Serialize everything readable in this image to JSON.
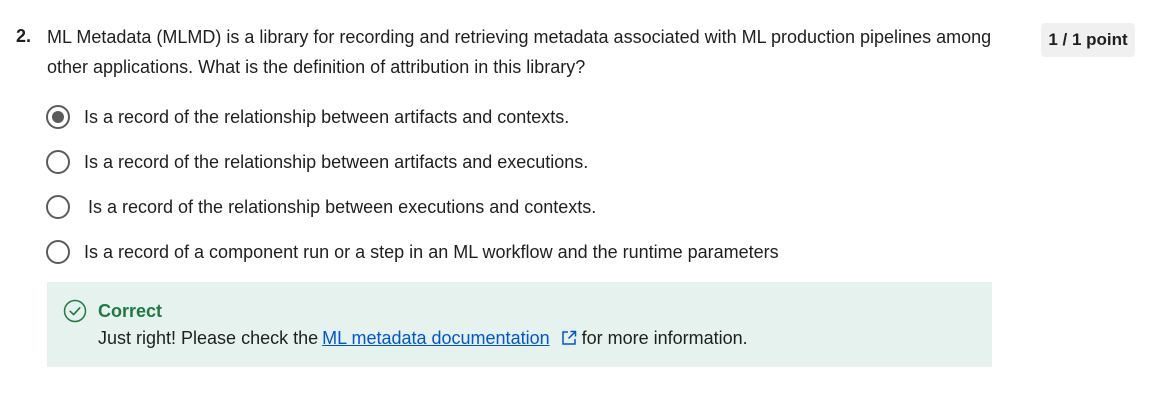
{
  "question": {
    "number": "2.",
    "text": "ML Metadata (MLMD) is a library for recording and retrieving metadata associated with ML production pipelines among other applications. What is the definition of attribution in this library?",
    "points": "1 / 1 point"
  },
  "options": [
    {
      "label": "Is a record of the relationship between artifacts and contexts.",
      "selected": true
    },
    {
      "label": "Is a record of the relationship between artifacts and executions.",
      "selected": false
    },
    {
      "label": "Is a record of the relationship between executions and contexts.",
      "selected": false
    },
    {
      "label": "Is a record of a component run or a step in an ML workflow and the runtime parameters",
      "selected": false
    }
  ],
  "feedback": {
    "title": "Correct",
    "body_prefix": "Just right! Please check the",
    "link_text": "ML metadata documentation",
    "body_suffix": "for more information.",
    "icon": "check-circle-icon",
    "link_icon": "external-link-icon"
  },
  "colors": {
    "correct_green": "#1e7a3f",
    "feedback_bg": "#e6f2ee",
    "link_blue": "#0056d2",
    "radio_gray": "#5b5b5b"
  }
}
